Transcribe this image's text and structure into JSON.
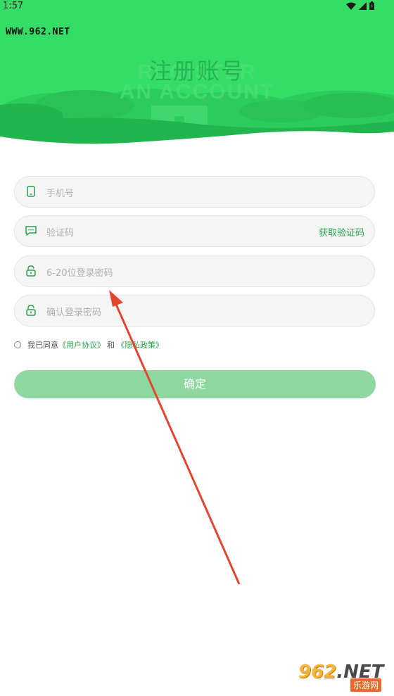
{
  "status_bar": {
    "time": "1:57"
  },
  "watermark_top": "WWW.962.NET",
  "header": {
    "bg_line1": "REGISTER",
    "bg_line2": "AN ACCOUNT",
    "title": "注册账号"
  },
  "form": {
    "phone_placeholder": "手机号",
    "code_placeholder": "验证码",
    "get_code_label": "获取验证码",
    "password_placeholder": "6-20位登录密码",
    "confirm_placeholder": "确认登录密码"
  },
  "agreement": {
    "prefix": "我已同意",
    "user_agreement": "《用户协议》",
    "and": "和",
    "privacy_policy": "《隐私政策》"
  },
  "submit_label": "确定",
  "corner_logo": {
    "main": "962",
    "net": ".NET",
    "sub": "乐游网"
  },
  "colors": {
    "header_green": "#33dd66",
    "accent_green": "#27a24b",
    "button_green": "#8fd7a0",
    "arrow_red": "#e2462f"
  }
}
